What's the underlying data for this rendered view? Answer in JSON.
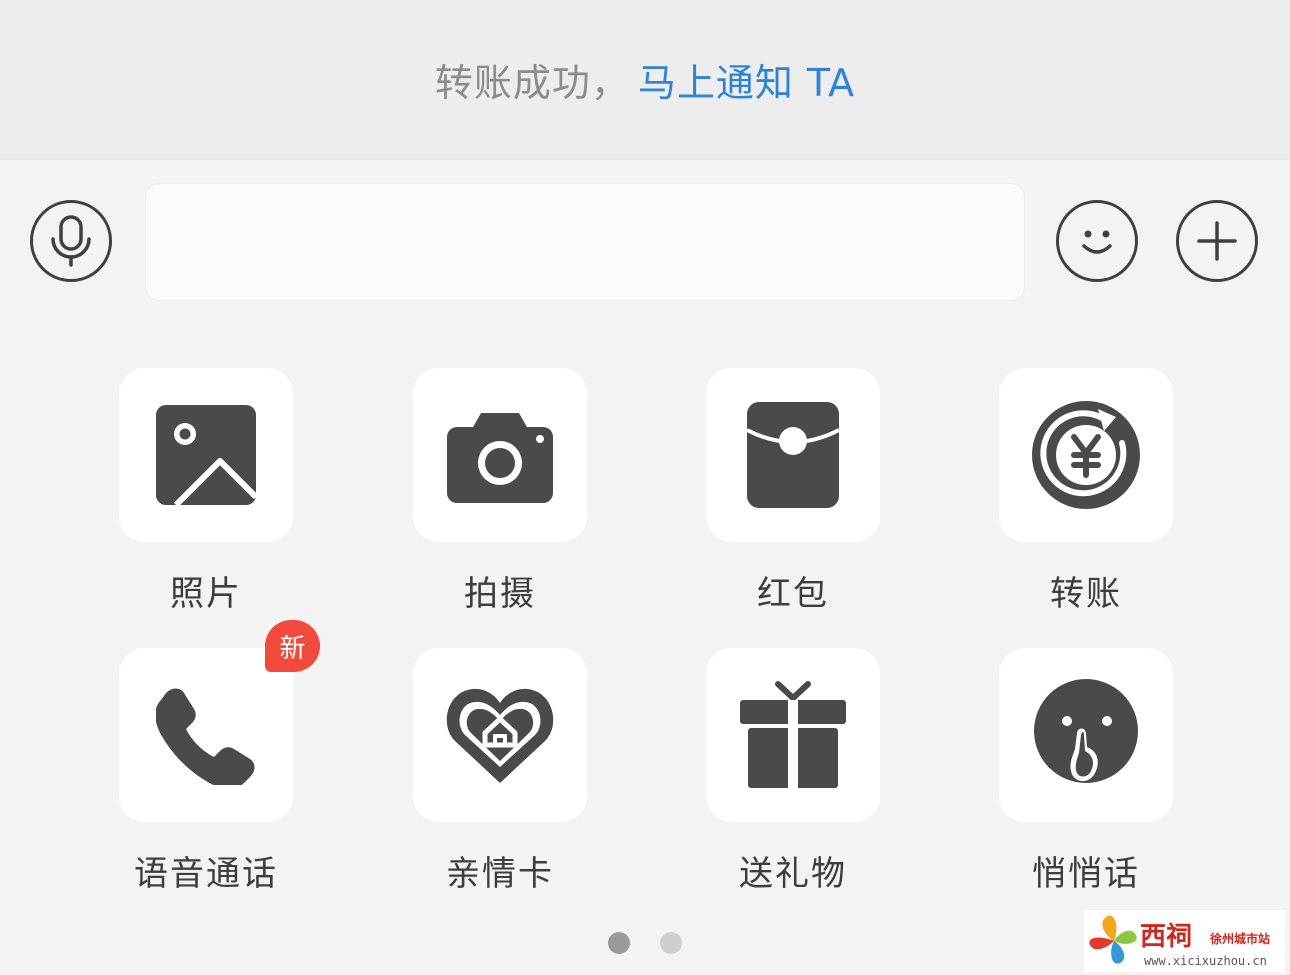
{
  "banner": {
    "message": "转账成功，",
    "link": "马上通知 TA"
  },
  "composer": {
    "mic_icon": "microphone-icon",
    "emoji_icon": "smiley-icon",
    "plus_icon": "plus-icon",
    "input_value": "",
    "input_placeholder": ""
  },
  "panel": {
    "items": [
      {
        "label": "照片",
        "icon": "photo-icon"
      },
      {
        "label": "拍摄",
        "icon": "camera-icon"
      },
      {
        "label": "红包",
        "icon": "red-packet-icon"
      },
      {
        "label": "转账",
        "icon": "transfer-yuan-icon"
      },
      {
        "label": "语音通话",
        "icon": "phone-icon",
        "badge": "新"
      },
      {
        "label": "亲情卡",
        "icon": "family-card-heart-icon"
      },
      {
        "label": "送礼物",
        "icon": "gift-icon"
      },
      {
        "label": "悄悄话",
        "icon": "whisper-face-icon"
      }
    ],
    "pagination": {
      "current": 1,
      "total": 2
    }
  },
  "colors": {
    "link": "#2f83d6",
    "badge": "#f24a3c",
    "icon": "#4a4a4a",
    "dot_active": "#9a9a9a",
    "dot_inactive": "#cfcfcf"
  },
  "watermark": {
    "title": "西祠",
    "subtitle": "徐州城市站",
    "url": "www.xicixuzhou.cn"
  }
}
